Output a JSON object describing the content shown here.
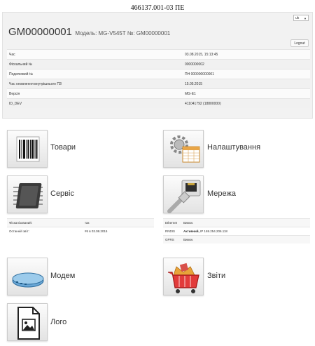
{
  "doc_title": "466137.001-03 ПЕ",
  "header": {
    "device_id": "GM00000001",
    "model_text": "Модель: MG-V545T №: GM00000001",
    "language": "uk",
    "logout_label": "Logout"
  },
  "info_rows": [
    {
      "label": "Час",
      "value": "03.08.2015, 15:13:45"
    },
    {
      "label": "Фіскальний №",
      "value": "0000000002"
    },
    {
      "label": "Податковий №",
      "value": "ПН 000000000001"
    },
    {
      "label": "Час оновлення внутрішнього ПЗ",
      "value": "15.05.2015"
    },
    {
      "label": "Версія",
      "value": "MG-E1"
    },
    {
      "label": "ID_DEV",
      "value": "411041792 (18800000)"
    }
  ],
  "tiles": {
    "goods": "Товари",
    "settings": "Налаштування",
    "service": "Сервіс",
    "network": "Мережа",
    "modem": "Модем",
    "reports": "Звіти",
    "logo": "Лого"
  },
  "service_status": [
    {
      "label": "Фіскалізований:",
      "value": "так"
    },
    {
      "label": "Останній звіт:",
      "value": "#6 в 03.08.2015"
    }
  ],
  "network_status": [
    {
      "label": "Ethernet",
      "value_bold": "",
      "value": "Вимкн."
    },
    {
      "label": "RNDIS",
      "value_bold": "Активний,",
      "value": "IP 169.254.206.118"
    },
    {
      "label": "GPRS",
      "value_bold": "",
      "value": "Вимкн."
    }
  ]
}
